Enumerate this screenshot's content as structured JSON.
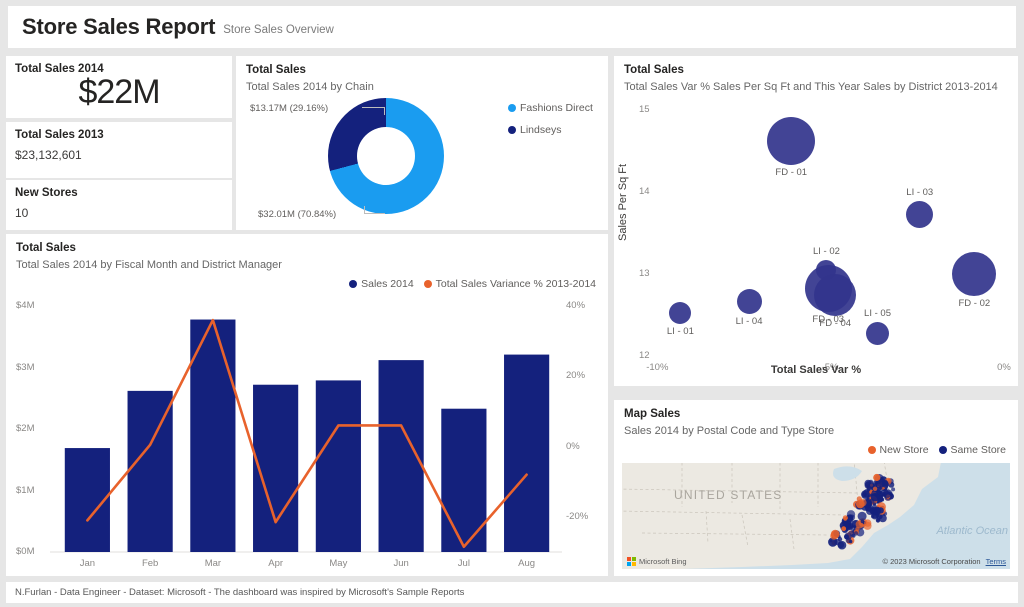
{
  "header": {
    "title": "Store Sales Report",
    "subtitle": "Store Sales Overview"
  },
  "kpis": [
    {
      "label": "Total Sales 2014",
      "value": "$22M"
    },
    {
      "label": "Total Sales 2013",
      "value": "$23,132,601"
    },
    {
      "label": "New Stores",
      "value": "10"
    }
  ],
  "donut": {
    "title": "Total Sales",
    "subtitle": "Total Sales 2014 by Chain",
    "label_top": "$13.17M (29.16%)",
    "label_bottom": "$32.01M (70.84%)",
    "legend": [
      {
        "name": "Fashions Direct",
        "color": "#1a9cf0"
      },
      {
        "name": "Lindseys",
        "color": "#14217d"
      }
    ]
  },
  "combo": {
    "title": "Total Sales",
    "subtitle": "Total Sales 2014 by Fiscal Month and District Manager",
    "legend": [
      {
        "name": "Sales 2014",
        "color": "#14217d"
      },
      {
        "name": "Total Sales Variance % 2013-2014",
        "color": "#e8622c"
      }
    ]
  },
  "scatter": {
    "title": "Total Sales",
    "subtitle": "Total Sales Var % Sales Per Sq Ft and This Year Sales by District 2013-2014",
    "xlabel": "Total Sales Var %",
    "ylabel": "Sales Per Sq Ft"
  },
  "map": {
    "title": "Map Sales",
    "subtitle": "Sales 2014 by Postal Code and Type Store",
    "legend": [
      {
        "name": "New Store",
        "color": "#e8622c"
      },
      {
        "name": "Same Store",
        "color": "#14217d"
      }
    ],
    "country_label": "UNITED STATES",
    "ocean_label": "Atlantic Ocean",
    "provider": "Microsoft Bing",
    "copyright": "© 2023 Microsoft Corporation",
    "terms": "Terms"
  },
  "footer": {
    "text": "N.Furlan - Data Engineer - Dataset: Microsoft - The dashboard was inspired by Microsoft's Sample Reports"
  },
  "chart_data": [
    {
      "type": "pie",
      "title": "Total Sales 2014 by Chain",
      "labels": [
        "Fashions Direct",
        "Lindseys"
      ],
      "values": [
        32.01,
        13.17
      ],
      "percents": [
        70.84,
        29.16
      ],
      "value_labels": [
        "$32.01M (70.84%)",
        "$13.17M (29.16%)"
      ],
      "colors": [
        "#1a9cf0",
        "#14217d"
      ],
      "legend_position": "right",
      "donut": true
    },
    {
      "type": "bar",
      "title": "Total Sales 2014 by Fiscal Month and District Manager",
      "categories": [
        "Jan",
        "Feb",
        "Mar",
        "Apr",
        "May",
        "Jun",
        "Jul",
        "Aug"
      ],
      "xlabel": "",
      "ylabel": "",
      "ylim": [
        0,
        4
      ],
      "yticks": [
        "$0M",
        "$1M",
        "$2M",
        "$3M",
        "$4M"
      ],
      "y2lim": [
        -30,
        40
      ],
      "y2ticks": [
        "-20%",
        "0%",
        "20%",
        "40%"
      ],
      "grid": false,
      "series": [
        {
          "name": "Sales 2014",
          "type": "bar",
          "axis": "left",
          "color": "#14217d",
          "values": [
            1.69,
            2.62,
            3.78,
            2.72,
            2.79,
            3.12,
            2.33,
            3.21
          ]
        },
        {
          "name": "Total Sales Variance % 2013-2014",
          "type": "line",
          "axis": "right",
          "color": "#e8622c",
          "values": [
            -21.0,
            0.5,
            36.0,
            -21.5,
            6.0,
            6.0,
            -28.5,
            -8.0
          ]
        }
      ]
    },
    {
      "type": "scatter",
      "title": "Total Sales Var % Sales Per Sq Ft and This Year Sales by District 2013-2014",
      "xlabel": "Total Sales Var %",
      "ylabel": "Sales Per Sq Ft",
      "xlim": [
        -10,
        0
      ],
      "xticks": [
        "-10%",
        "-5%",
        "0%"
      ],
      "ylim": [
        12,
        15
      ],
      "yticks": [
        "12",
        "13",
        "14",
        "15"
      ],
      "grid": false,
      "color": "#32348c",
      "size_field": "This Year Sales",
      "points": [
        {
          "label": "FD - 01",
          "x": -6.1,
          "y": 14.62,
          "size": 48
        },
        {
          "label": "FD - 02",
          "x": -0.9,
          "y": 13.0,
          "size": 44
        },
        {
          "label": "FD - 03",
          "x": -5.05,
          "y": 12.82,
          "size": 47
        },
        {
          "label": "FD - 04",
          "x": -4.85,
          "y": 12.74,
          "size": 42
        },
        {
          "label": "LI - 01",
          "x": -9.25,
          "y": 12.53,
          "size": 22
        },
        {
          "label": "LI - 02",
          "x": -5.1,
          "y": 13.05,
          "size": 20
        },
        {
          "label": "LI - 03",
          "x": -2.45,
          "y": 13.72,
          "size": 27
        },
        {
          "label": "LI - 04",
          "x": -7.3,
          "y": 12.66,
          "size": 25
        },
        {
          "label": "LI - 05",
          "x": -3.65,
          "y": 12.28,
          "size": 23
        }
      ]
    },
    {
      "type": "scatter",
      "title": "Sales 2014 by Postal Code and Type Store",
      "subtype": "map-bubble",
      "legend": [
        "New Store",
        "Same Store"
      ],
      "colors": [
        "#e8622c",
        "#14217d"
      ],
      "region": "Eastern United States"
    }
  ]
}
